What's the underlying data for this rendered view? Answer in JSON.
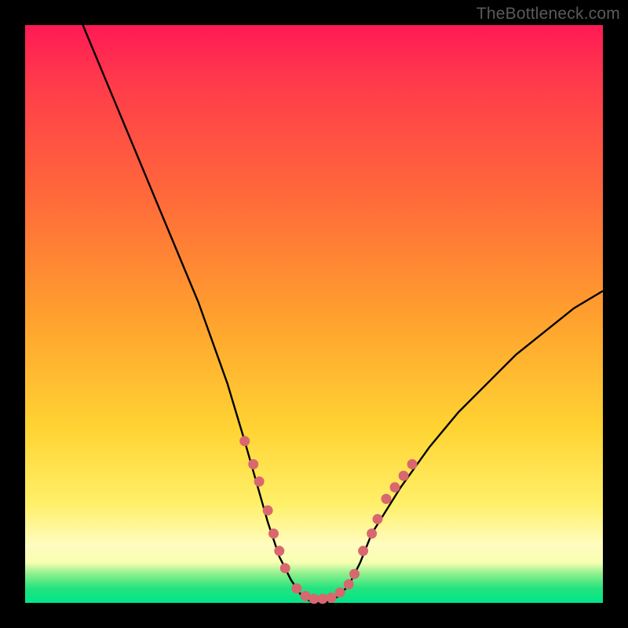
{
  "watermark": "TheBottleneck.com",
  "chart_data": {
    "type": "line",
    "title": "",
    "xlabel": "",
    "ylabel": "",
    "xlim": [
      0,
      100
    ],
    "ylim": [
      0,
      100
    ],
    "series": [
      {
        "name": "bottleneck-curve",
        "x": [
          10,
          15,
          20,
          25,
          30,
          35,
          38,
          40,
          42,
          44,
          46,
          48,
          50,
          52,
          54,
          56,
          58,
          60,
          65,
          70,
          75,
          80,
          85,
          90,
          95,
          100
        ],
        "values": [
          100,
          88,
          76,
          64,
          52,
          38,
          28,
          21,
          14,
          8,
          4,
          1,
          0,
          0,
          1,
          3,
          7,
          12,
          20,
          27,
          33,
          38,
          43,
          47,
          51,
          54
        ]
      }
    ],
    "highlight_clusters": [
      {
        "name": "left-descent-dots",
        "points": [
          {
            "x": 38,
            "y": 28
          },
          {
            "x": 39.5,
            "y": 24
          },
          {
            "x": 40.5,
            "y": 21
          },
          {
            "x": 42,
            "y": 16
          },
          {
            "x": 43,
            "y": 12
          },
          {
            "x": 44,
            "y": 9
          },
          {
            "x": 45,
            "y": 6
          }
        ]
      },
      {
        "name": "valley-dots",
        "points": [
          {
            "x": 47,
            "y": 2.5
          },
          {
            "x": 48.5,
            "y": 1.2
          },
          {
            "x": 50,
            "y": 0.7
          },
          {
            "x": 51.5,
            "y": 0.7
          },
          {
            "x": 53,
            "y": 0.9
          },
          {
            "x": 54.5,
            "y": 1.8
          },
          {
            "x": 56,
            "y": 3.2
          },
          {
            "x": 57,
            "y": 5
          }
        ]
      },
      {
        "name": "right-ascent-dots",
        "points": [
          {
            "x": 58.5,
            "y": 9
          },
          {
            "x": 60,
            "y": 12
          },
          {
            "x": 61,
            "y": 14.5
          },
          {
            "x": 62.5,
            "y": 18
          },
          {
            "x": 64,
            "y": 20
          },
          {
            "x": 65.5,
            "y": 22
          },
          {
            "x": 67,
            "y": 24
          }
        ]
      }
    ],
    "gradient_stops": [
      {
        "pos": 0,
        "color": "#ff1a55"
      },
      {
        "pos": 0.1,
        "color": "#ff3b4b"
      },
      {
        "pos": 0.3,
        "color": "#ff6a3a"
      },
      {
        "pos": 0.5,
        "color": "#ff9f2e"
      },
      {
        "pos": 0.7,
        "color": "#ffd433"
      },
      {
        "pos": 0.83,
        "color": "#fff06a"
      },
      {
        "pos": 0.9,
        "color": "#fffcbf"
      },
      {
        "pos": 0.93,
        "color": "#f8feb2"
      },
      {
        "pos": 0.95,
        "color": "#8cf08c"
      },
      {
        "pos": 0.975,
        "color": "#23e37e"
      },
      {
        "pos": 1.0,
        "color": "#00e58a"
      }
    ],
    "dot_color": "#d9676f",
    "curve_color": "#000000"
  }
}
